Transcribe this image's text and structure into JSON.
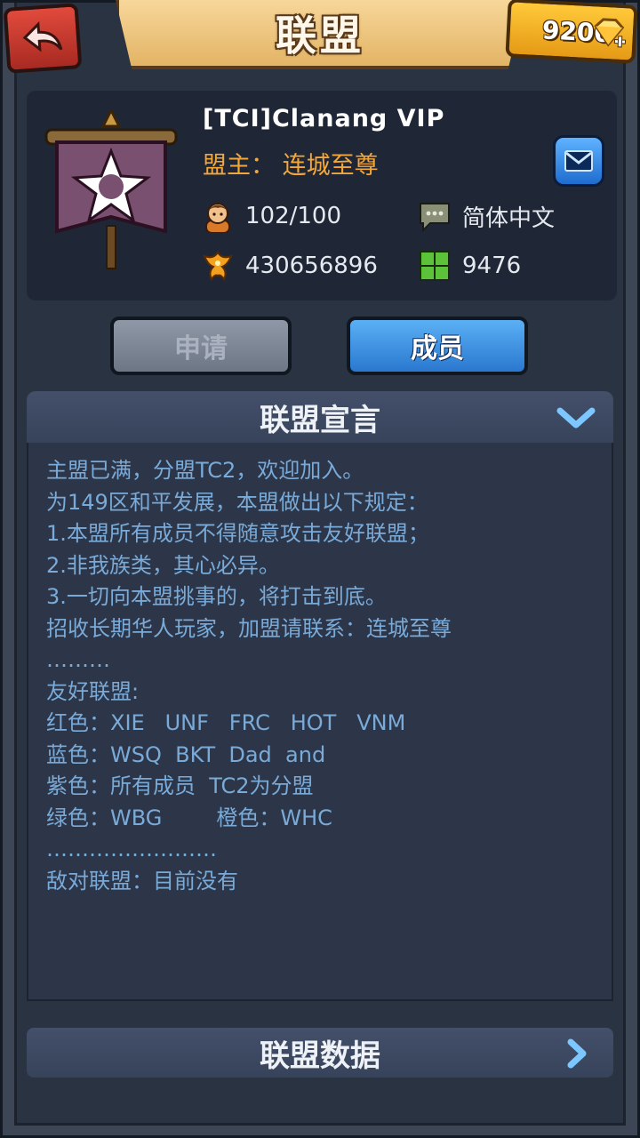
{
  "header": {
    "title": "联盟",
    "gems": "9200"
  },
  "clan": {
    "name": "[TCI]Clanang  VIP",
    "leader": "盟主： 连城至尊",
    "members": "102/100",
    "language": "简体中文",
    "power": "430656896",
    "territory": "9476"
  },
  "buttons": {
    "apply": "申请",
    "members": "成员"
  },
  "manifesto": {
    "title": "联盟宣言",
    "lines": [
      "主盟已满，分盟TC2，欢迎加入。",
      "为149区和平发展，本盟做出以下规定：",
      "1.本盟所有成员不得随意攻击友好联盟；",
      "2.非我族类，其心必异。",
      "3.一切向本盟挑事的，将打击到底。",
      "招收长期华人玩家，加盟请联系：连城至尊",
      "………",
      "友好联盟:",
      "红色：XIE   UNF   FRC   HOT   VNM",
      "蓝色：WSQ  BKT  Dad  and",
      "紫色：所有成员  TC2为分盟",
      "绿色：WBG        橙色：WHC",
      "……………………",
      "敌对联盟：目前没有"
    ]
  },
  "data_section": {
    "title": "联盟数据"
  },
  "colors": {
    "accent_orange": "#f3a73a",
    "text_blue": "#7aaad8",
    "button_blue": "#3a8ae0"
  }
}
